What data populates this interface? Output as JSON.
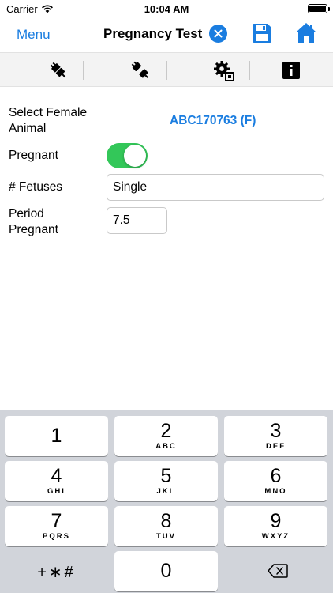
{
  "status_bar": {
    "carrier": "Carrier",
    "time": "10:04 AM",
    "icons": [
      "wifi-icon",
      "battery-icon"
    ]
  },
  "nav": {
    "menu_label": "Menu",
    "title": "Pregnancy Test",
    "icons": [
      "close-circle-icon",
      "save-floppy-icon",
      "home-icon"
    ],
    "accent_color": "#1a7de0"
  },
  "toolbar": {
    "icons": [
      "plug-connected-icon",
      "plug-disconnected-icon",
      "settings-gear-icon",
      "info-icon"
    ]
  },
  "form": {
    "animal_label": "Select Female Animal",
    "animal_value": "ABC170763 (F)",
    "pregnant_label": "Pregnant",
    "pregnant_on": true,
    "toggle_color": "#33c759",
    "fetuses_label": "# Fetuses",
    "fetuses_value": "Single",
    "period_label": "Period Pregnant",
    "period_value": "7.5"
  },
  "keypad": {
    "keys": [
      {
        "digit": "1",
        "letters": ""
      },
      {
        "digit": "2",
        "letters": "ABC"
      },
      {
        "digit": "3",
        "letters": "DEF"
      },
      {
        "digit": "4",
        "letters": "GHI"
      },
      {
        "digit": "5",
        "letters": "JKL"
      },
      {
        "digit": "6",
        "letters": "MNO"
      },
      {
        "digit": "7",
        "letters": "PQRS"
      },
      {
        "digit": "8",
        "letters": "TUV"
      },
      {
        "digit": "9",
        "letters": "WXYZ"
      }
    ],
    "symbols_label": "+∗#",
    "zero": "0"
  }
}
